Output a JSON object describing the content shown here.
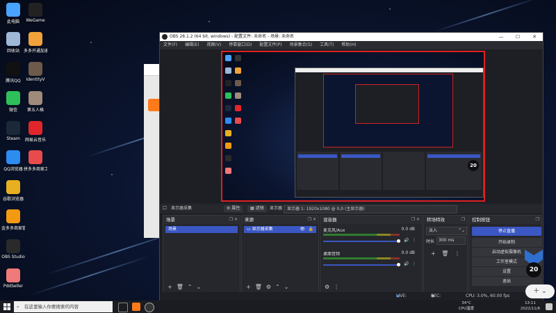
{
  "desktop": {
    "icons": [
      {
        "label": "此电脑",
        "color": "#4aa3ff"
      },
      {
        "label": "WeGame",
        "color": "#222222"
      },
      {
        "label": "回收站",
        "color": "#9fb8d8"
      },
      {
        "label": "多多开通加速器",
        "color": "#f2a23a"
      },
      {
        "label": "腾讯QQ",
        "color": "#111111"
      },
      {
        "label": "IdentityV",
        "color": "#6d5a4a"
      },
      {
        "label": "微信",
        "color": "#2fbf5a"
      },
      {
        "label": "第五人格",
        "color": "#a08a7a"
      },
      {
        "label": "Steam",
        "color": "#1b2838"
      },
      {
        "label": "网易云音乐",
        "color": "#e0262a"
      },
      {
        "label": "QQ浏览器",
        "color": "#2d8cf0"
      },
      {
        "label": "拼多多商家工作台",
        "color": "#e84b4b"
      },
      {
        "label": "谷歌浏览器",
        "color": "#e8b020"
      },
      {
        "label": "金多多商家管理",
        "color": "#f39a12"
      },
      {
        "label": "OBS Studio",
        "color": "#2a2a2a"
      },
      {
        "label": "PddSeller",
        "color": "#f07a7a"
      }
    ]
  },
  "obs": {
    "title": "OBS 28.1.2 (64 bit, windows) - 配置文件: 未命名 - 场景: 未命名",
    "window_controls": [
      "—",
      "☐",
      "✕"
    ],
    "menu": [
      "文件(F)",
      "编辑(E)",
      "视图(V)",
      "停靠窗口(D)",
      "配置文件(P)",
      "场景集合(S)",
      "工具(T)",
      "帮助(H)"
    ],
    "source_toolbar": {
      "source_name": "显示器采集",
      "properties": "属性",
      "filters": "滤镜",
      "display_label": "显示器",
      "display_value": "显示器 1: 1920x1080 @ 0,0 (主显示器)"
    },
    "docks": {
      "scenes": {
        "title": "场景",
        "items": [
          "场景"
        ]
      },
      "sources": {
        "title": "来源",
        "items": [
          "显示器采集"
        ]
      },
      "mixer": {
        "title": "混音器",
        "channels": [
          {
            "name": "麦克风/Aux",
            "db": "0.0 dB"
          },
          {
            "name": "桌面音频",
            "db": "0.0 dB"
          }
        ],
        "ticks": [
          "-60",
          "-55",
          "-50",
          "-45",
          "-40",
          "-35",
          "-30",
          "-25",
          "-20",
          "-15",
          "-10",
          "-5",
          "0"
        ]
      },
      "transitions": {
        "title": "转场特效",
        "type": "淡入",
        "duration_label": "时长",
        "duration_value": "300 ms"
      },
      "controls": {
        "title": "控制按钮",
        "buttons": [
          "停止直播",
          "开始录制",
          "启动虚拟摄像机",
          "工作室模式",
          "设置",
          "退出"
        ]
      }
    },
    "status": {
      "live": "LIVE: 00:00:00",
      "rec": "REC: 00:00:00",
      "cpu": "CPU: 3.0%, 60.00 fps"
    }
  },
  "taskbar": {
    "search_placeholder": "在这里输入你要搜索的内容",
    "weather_temp": "34°C",
    "weather_text": "CPU温度",
    "time": "13:11",
    "date": "2022/11/6"
  },
  "overlay": {
    "badge": "20"
  }
}
